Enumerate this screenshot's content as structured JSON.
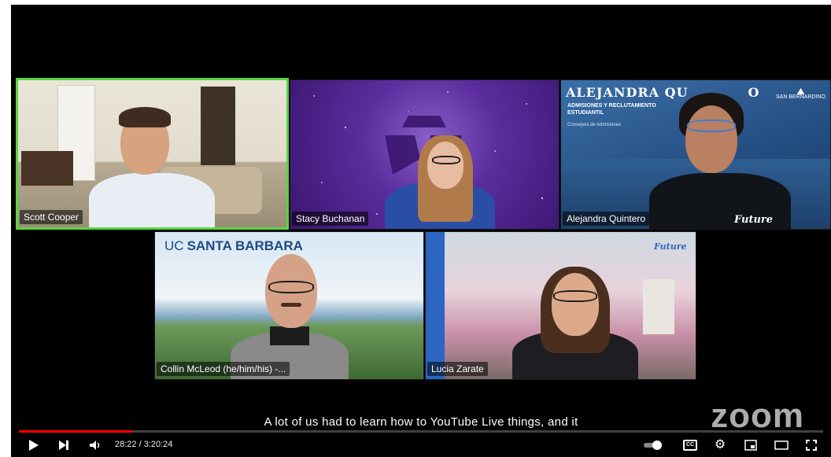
{
  "player": {
    "caption": "A lot of us had to learn how to YouTube Live things, and it",
    "watermark": "zoom",
    "time_display": "28:22 / 3:20:24",
    "progress_fraction": 0.1417,
    "cc_label": "CC"
  },
  "participants": [
    {
      "name": "Scott Cooper",
      "active": true
    },
    {
      "name": "Stacy Buchanan",
      "active": false
    },
    {
      "name": "Alejandra Quintero",
      "active": false
    },
    {
      "name": "Collin McLeod (he/him/his) -...",
      "active": false
    },
    {
      "name": "Lucia Zarate",
      "active": false
    }
  ],
  "backgrounds": {
    "alejandra_title": "ALEJANDRA QU",
    "alejandra_title_end": "O",
    "alejandra_role": "ADMISIONES Y RECLUTAMIENTO ESTUDIANTIL",
    "alejandra_dept": "Consejera de Admisiones",
    "san_bernardino": "SAN BERNARDINO",
    "ucsb_uc": "UC",
    "ucsb_name": "SANTA BARBARA",
    "future": "Future"
  },
  "colors": {
    "active_border": "#57d640",
    "progress": "#ff0000"
  },
  "icons": [
    "play-icon",
    "next-icon",
    "volume-icon",
    "autoplay-toggle-icon",
    "cc-icon",
    "settings-icon",
    "miniplayer-icon",
    "theater-icon",
    "fullscreen-icon"
  ]
}
